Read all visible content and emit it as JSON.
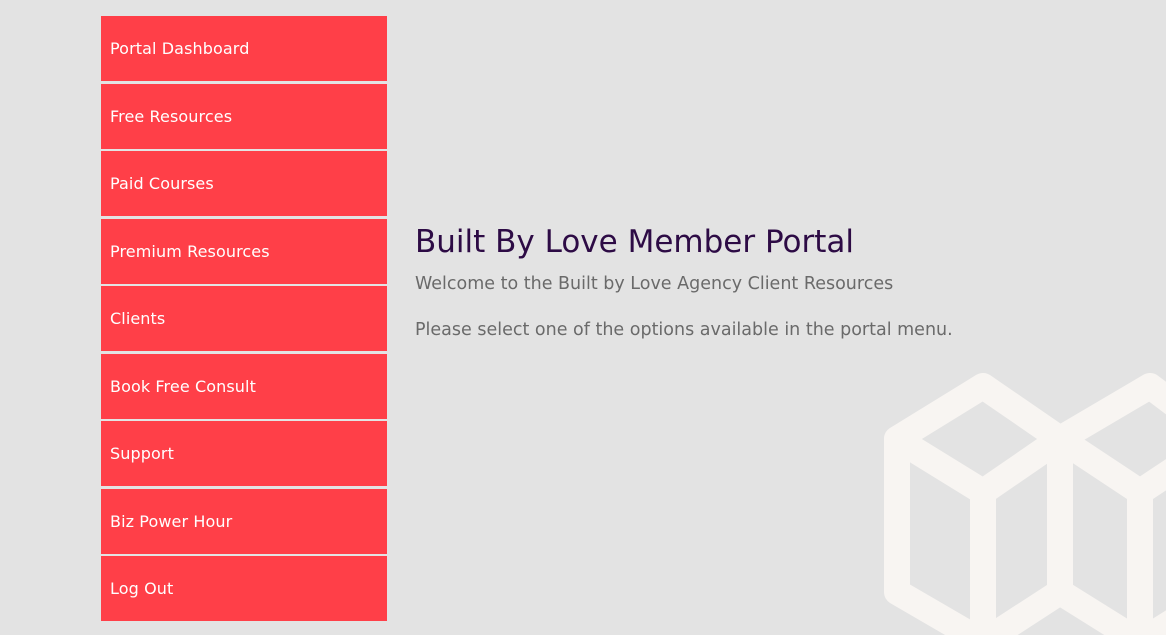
{
  "colors": {
    "background": "#e3e3e3",
    "menu_item": "#ff3f48",
    "menu_text": "#ffffff",
    "title": "#2d0b45",
    "body_text": "#6a6a6a",
    "logo_watermark": "#f8f5f2"
  },
  "sidebar": {
    "items": [
      {
        "label": "Portal Dashboard"
      },
      {
        "label": "Free Resources"
      },
      {
        "label": "Paid Courses"
      },
      {
        "label": "Premium Resources"
      },
      {
        "label": "Clients"
      },
      {
        "label": "Book Free Consult"
      },
      {
        "label": "Support"
      },
      {
        "label": "Biz Power Hour"
      },
      {
        "label": "Log Out"
      }
    ]
  },
  "main": {
    "title": "Built By Love Member Portal",
    "welcome": "Welcome to the Built by Love Agency Client Resources",
    "instruction": "Please select one of the options available in the portal menu."
  },
  "decoration": {
    "icon": "cube-logo-icon"
  }
}
